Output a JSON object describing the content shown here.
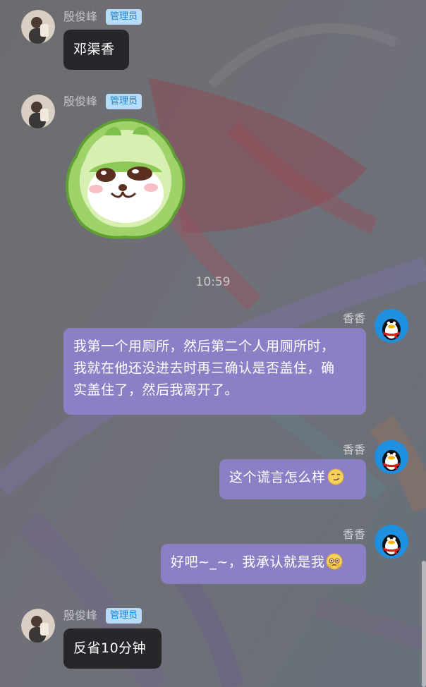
{
  "messages": [
    {
      "sender": "殷俊峰",
      "badge": "管理员",
      "text": "邓渠香"
    },
    {
      "sender": "殷俊峰",
      "badge": "管理员",
      "sticker": "cabbage-dog-sticker"
    },
    {
      "time": "10:59"
    },
    {
      "sender": "香香",
      "lines": [
        "我第一个用厕所，然后第二个人用厕所时，",
        "我就在他还没进去时再三确认是否盖住，确",
        "实盖住了，然后我离开了。"
      ]
    },
    {
      "sender": "香香",
      "text": "这个谎言怎么样",
      "emoji": "smirk-emoji"
    },
    {
      "sender": "香香",
      "text": "好吧~_~，我承认就是我",
      "emoji": "pleading-emoji"
    },
    {
      "sender": "殷俊峰",
      "badge": "管理员",
      "text": "反省10分钟"
    }
  ],
  "colors": {
    "bubble_other": "#26262b",
    "bubble_self": "#8b80c6",
    "badge_bg": "#b7dcf6",
    "badge_text": "#1f86d6"
  }
}
